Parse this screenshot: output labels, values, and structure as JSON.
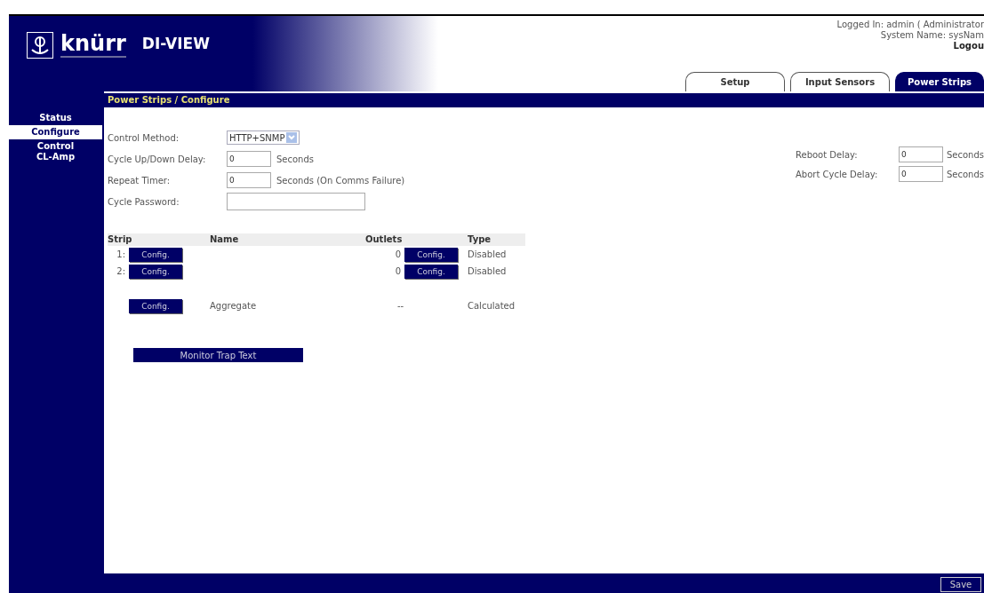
{
  "header": {
    "brand": "knürr",
    "product": "DI-VIEW",
    "user_lines": [
      "Logged In: admin ( Administrator",
      "System Name: sysNam"
    ],
    "logout": "Logou"
  },
  "tabs": [
    {
      "label": "Setup",
      "selected": false
    },
    {
      "label": "Input Sensors",
      "selected": false
    },
    {
      "label": "Power Strips",
      "selected": true
    }
  ],
  "sidebar": {
    "items": [
      {
        "label": "Status",
        "selected": false
      },
      {
        "label": "Configure",
        "selected": true
      },
      {
        "label": "Control",
        "selected": false
      },
      {
        "label": "CL-Amp",
        "selected": false
      }
    ]
  },
  "panel_title": "Power Strips / Configure",
  "form_left": [
    {
      "kind": "select",
      "label": "Control Method:",
      "value": "HTTP+SNMP"
    },
    {
      "kind": "number",
      "label": "Cycle Up/Down Delay:",
      "value": "0",
      "unit": "Seconds"
    },
    {
      "kind": "number",
      "label": "Repeat Timer:",
      "value": "0",
      "unit": "Seconds (On Comms Failure)"
    },
    {
      "kind": "password",
      "label": "Cycle Password:"
    }
  ],
  "form_right": [
    {
      "label": "Reboot Delay:",
      "value": "0",
      "unit": "Seconds"
    },
    {
      "label": "Abort Cycle Delay:",
      "value": "0",
      "unit": "Seconds"
    }
  ],
  "table": {
    "columns": [
      "Strip",
      "Name",
      "Outlets",
      "Type"
    ],
    "rows": [
      {
        "index": "1:",
        "button": "Config.",
        "outlets": "0",
        "outlet_button": "Config.",
        "type": "Disabled"
      },
      {
        "index": "2:",
        "button": "Config.",
        "outlets": "0",
        "outlet_button": "Config.",
        "type": "Disabled"
      }
    ],
    "aggregate": {
      "button": "Config.",
      "name": "Aggregate",
      "outlets": "--",
      "type": "Calculated"
    }
  },
  "trap_button": "Monitor Trap Text",
  "save_button": "Save"
}
